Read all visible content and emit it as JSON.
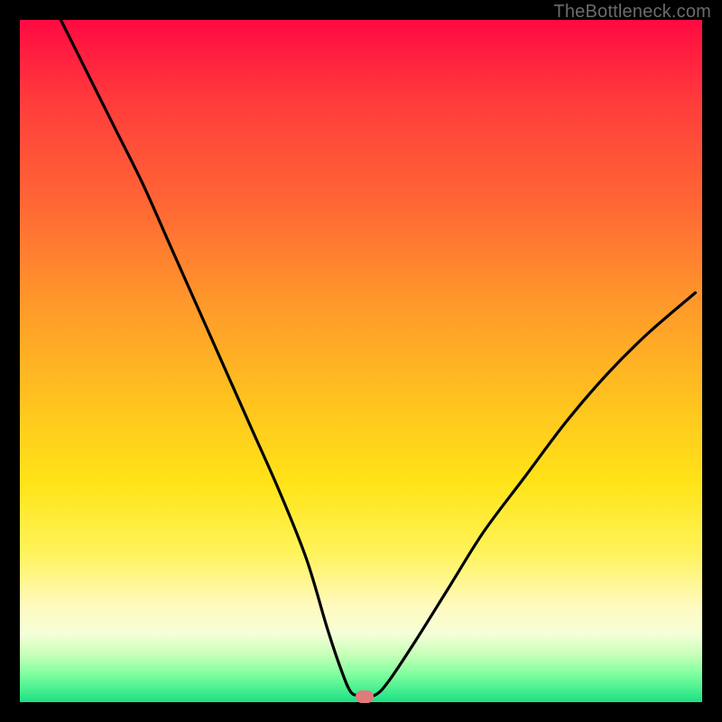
{
  "watermark": "TheBottleneck.com",
  "chart_data": {
    "type": "line",
    "title": "",
    "xlabel": "",
    "ylabel": "",
    "xlim": [
      0,
      100
    ],
    "ylim": [
      0,
      100
    ],
    "grid": false,
    "legend": false,
    "series": [
      {
        "name": "bottleneck-curve",
        "x": [
          6,
          10,
          14,
          18,
          22,
          26,
          30,
          34,
          38,
          42,
          45,
          47,
          48.5,
          50,
          52,
          54,
          58,
          63,
          68,
          74,
          80,
          86,
          92,
          99
        ],
        "y": [
          100,
          92,
          84,
          76,
          67,
          58,
          49,
          40,
          31,
          21,
          11,
          5,
          1.5,
          1,
          1,
          3,
          9,
          17,
          25,
          33,
          41,
          48,
          54,
          60
        ]
      }
    ],
    "marker": {
      "x": 50.5,
      "y": 0.8,
      "color": "#e07b7b"
    },
    "background_gradient": {
      "stops": [
        {
          "pos": 0.0,
          "color": "#ff0a42"
        },
        {
          "pos": 0.28,
          "color": "#ff6a34"
        },
        {
          "pos": 0.56,
          "color": "#ffc31f"
        },
        {
          "pos": 0.78,
          "color": "#fff35a"
        },
        {
          "pos": 0.9,
          "color": "#f5ffd8"
        },
        {
          "pos": 1.0,
          "color": "#1be084"
        }
      ]
    }
  }
}
